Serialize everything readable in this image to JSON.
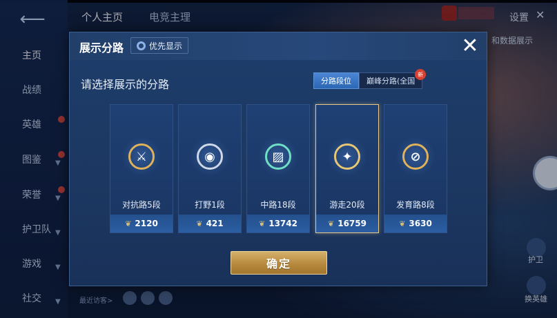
{
  "background": {
    "top_tabs": [
      "个人主页",
      "电竞主理"
    ],
    "settings_label": "设置",
    "right_label": "和数据展示",
    "nav_items": [
      "主页",
      "战绩",
      "英雄",
      "图鉴",
      "荣誉",
      "护卫队",
      "游戏",
      "社交"
    ],
    "footer_visitors": "最近访客>",
    "bottom_right_labels": [
      "护卫",
      "换英雄"
    ]
  },
  "modal": {
    "title": "展示分路",
    "priority_label": "优先显示",
    "prompt": "请选择展示的分路",
    "tabs": [
      {
        "label": "分路段位",
        "active": true
      },
      {
        "label": "巅峰分路(全国",
        "active": false,
        "badge": "新"
      }
    ],
    "cards": [
      {
        "name": "对抗路5段",
        "score": "2120",
        "glyph": "⚔",
        "selected": false
      },
      {
        "name": "打野1段",
        "score": "421",
        "glyph": "◉",
        "selected": false
      },
      {
        "name": "中路18段",
        "score": "13742",
        "glyph": "▨",
        "selected": false
      },
      {
        "name": "游走20段",
        "score": "16759",
        "glyph": "✦",
        "selected": true
      },
      {
        "name": "发育路8段",
        "score": "3630",
        "glyph": "⊘",
        "selected": false
      }
    ],
    "confirm_label": "确定"
  },
  "colors": {
    "accent_gold": "#e0b25a",
    "tab_active": "#3a78c8",
    "modal_bg": "#1e3d6b"
  }
}
